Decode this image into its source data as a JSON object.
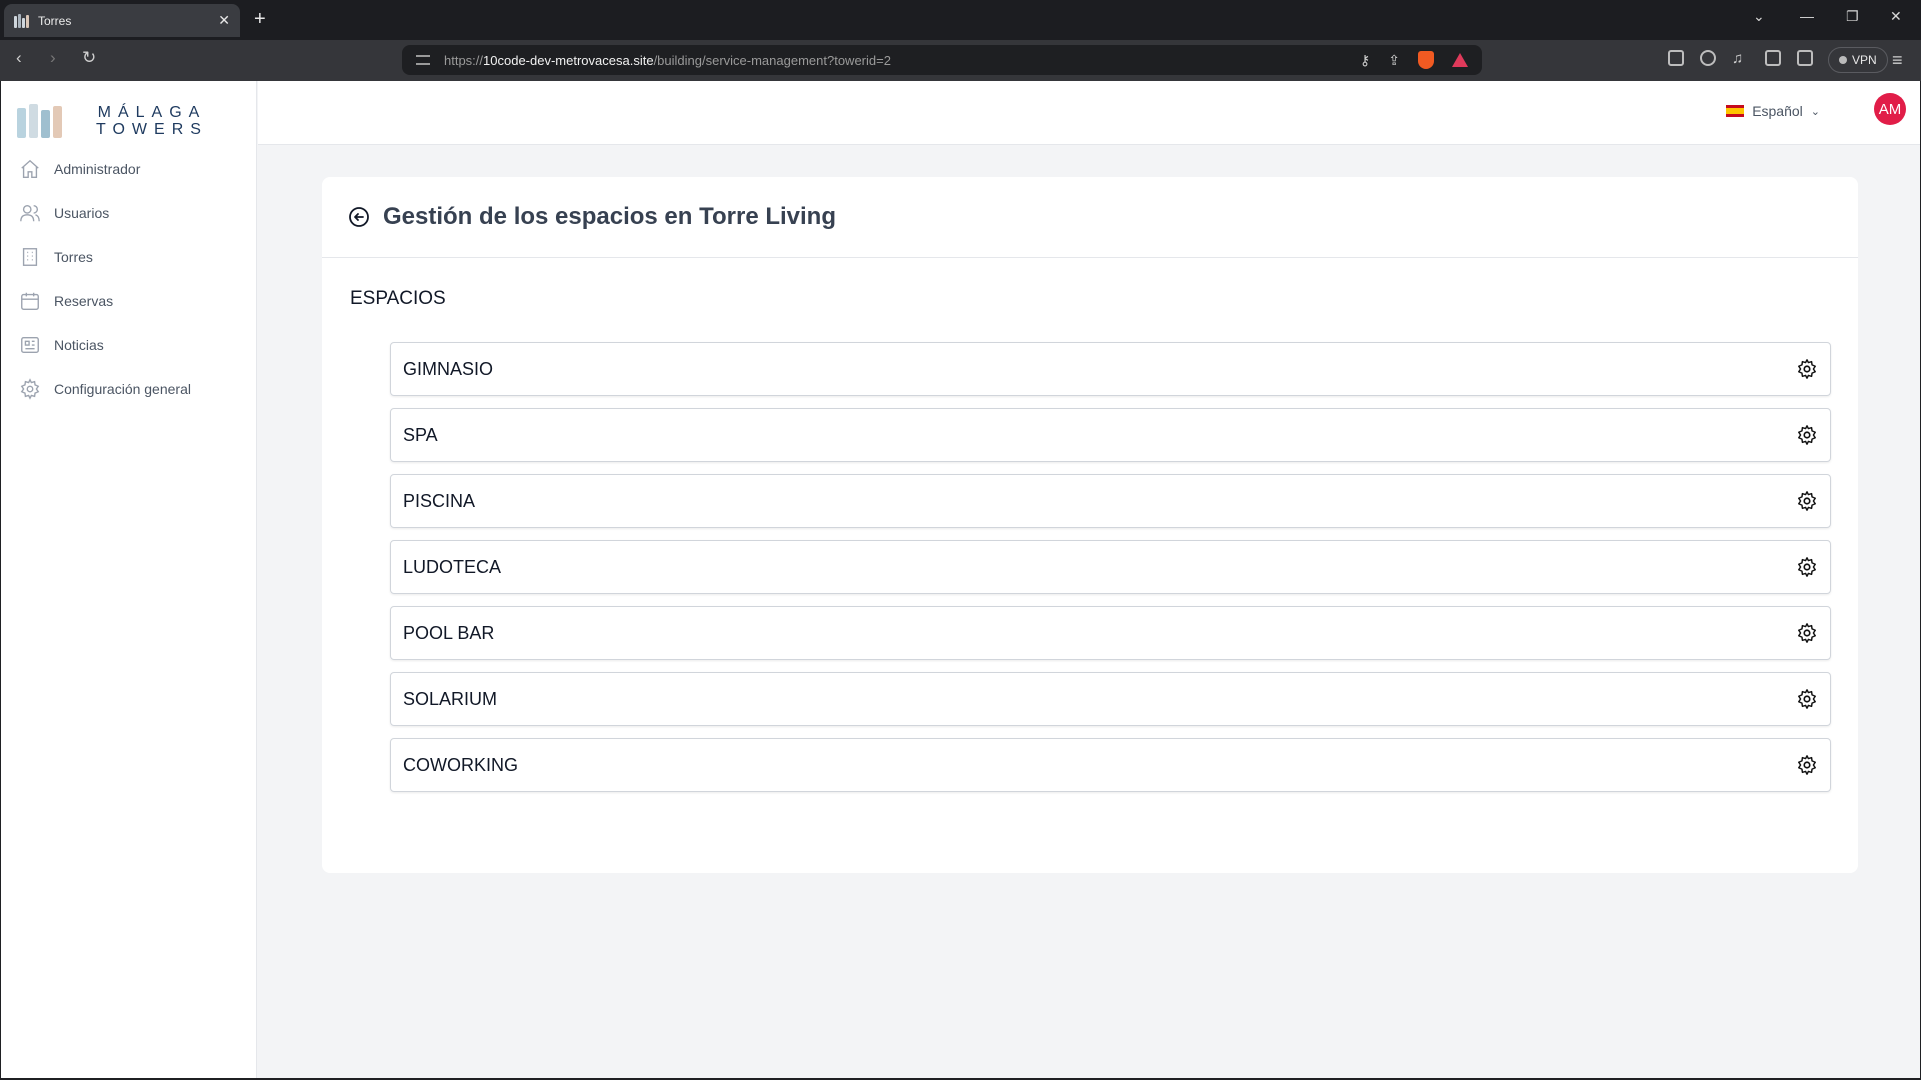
{
  "browser": {
    "tab_title": "Torres",
    "tab_close": "✕",
    "new_tab": "+",
    "url_prefix": "https://",
    "url_host": "10code-dev-metrovacesa.site",
    "url_path": "/building/service-management?towerid=2",
    "vpn_label": "VPN"
  },
  "brand": {
    "line1": "MÁLAGA",
    "line2": "TOWERS"
  },
  "sidebar": {
    "items": [
      {
        "label": "Administrador",
        "icon": "home-icon"
      },
      {
        "label": "Usuarios",
        "icon": "users-icon"
      },
      {
        "label": "Torres",
        "icon": "building-icon"
      },
      {
        "label": "Reservas",
        "icon": "calendar-icon"
      },
      {
        "label": "Noticias",
        "icon": "newspaper-icon"
      },
      {
        "label": "Configuración general",
        "icon": "settings-icon"
      }
    ]
  },
  "header": {
    "language": "Español",
    "avatar_initials": "AM"
  },
  "main": {
    "title": "Gestión de los espacios en Torre Living",
    "section_title": "ESPACIOS",
    "spaces": [
      "GIMNASIO",
      "SPA",
      "PISCINA",
      "LUDOTECA",
      "POOL BAR",
      "SOLARIUM",
      "COWORKING"
    ]
  },
  "colors": {
    "avatar": "#e11d48",
    "page_bg": "#f3f4f6",
    "brand_text": "#1e3a5f"
  }
}
